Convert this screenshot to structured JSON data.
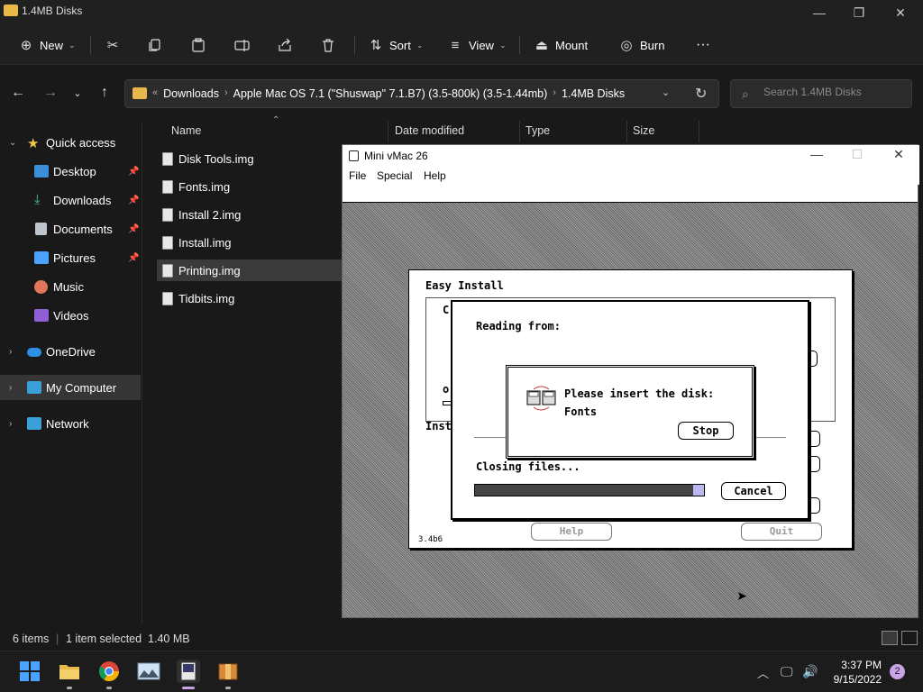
{
  "window": {
    "title": "1.4MB Disks",
    "minimize": "—",
    "maximize": "❐",
    "close": "✕"
  },
  "toolbar": {
    "new_label": "New",
    "sort_label": "Sort",
    "view_label": "View",
    "mount_label": "Mount",
    "burn_label": "Burn",
    "more_label": "···"
  },
  "address": {
    "crumbs": [
      "Downloads",
      "Apple Mac OS 7.1 (\"Shuswap\" 7.1.B7) (3.5-800k) (3.5-1.44mb)",
      "1.4MB Disks"
    ],
    "search_placeholder": "Search 1.4MB Disks"
  },
  "sidebar": {
    "items": [
      {
        "label": "Quick access"
      },
      {
        "label": "Desktop",
        "pinned": true
      },
      {
        "label": "Downloads",
        "pinned": true
      },
      {
        "label": "Documents",
        "pinned": true
      },
      {
        "label": "Pictures",
        "pinned": true
      },
      {
        "label": "Music"
      },
      {
        "label": "Videos"
      },
      {
        "label": "OneDrive"
      },
      {
        "label": "My Computer",
        "selected": true
      },
      {
        "label": "Network"
      }
    ]
  },
  "columns": {
    "name": "Name",
    "date": "Date modified",
    "type": "Type",
    "size": "Size"
  },
  "files": [
    {
      "name": "Disk Tools.img"
    },
    {
      "name": "Fonts.img"
    },
    {
      "name": "Install 2.img"
    },
    {
      "name": "Install.img"
    },
    {
      "name": "Printing.img",
      "selected": true
    },
    {
      "name": "Tidbits.img"
    }
  ],
  "status": {
    "items": "6 items",
    "selection": "1 item selected  1.40 MB"
  },
  "vmac": {
    "title": "Mini vMac 26",
    "menu": [
      "File",
      "Special",
      "Help"
    ],
    "easy_install": {
      "title": "Easy Install",
      "partial_c": "C",
      "partial_o": "o",
      "partial_install": "Insta",
      "partial_fonts": "onts",
      "partial_i": "I",
      "version": "3.4b6",
      "help_label": "Help",
      "quit_label": "Quit"
    },
    "reading": {
      "reading_from": "Reading from:",
      "closing": "Closing files...",
      "cancel_label": "Cancel",
      "progress": 0.97
    },
    "insert": {
      "message": "Please insert the disk:",
      "disk": "Fonts",
      "stop_label": "Stop"
    }
  },
  "taskbar": {
    "time": "3:37 PM",
    "date": "9/15/2022",
    "notifications": "2",
    "apps": [
      "start-icon",
      "file-explorer-icon",
      "chrome-icon",
      "photos-icon",
      "mini-vmac-icon",
      "archive-icon"
    ]
  },
  "colors": {
    "folder": "#e8b84a",
    "star": "#f2c744",
    "accent_blue": "#4aa3ff"
  }
}
